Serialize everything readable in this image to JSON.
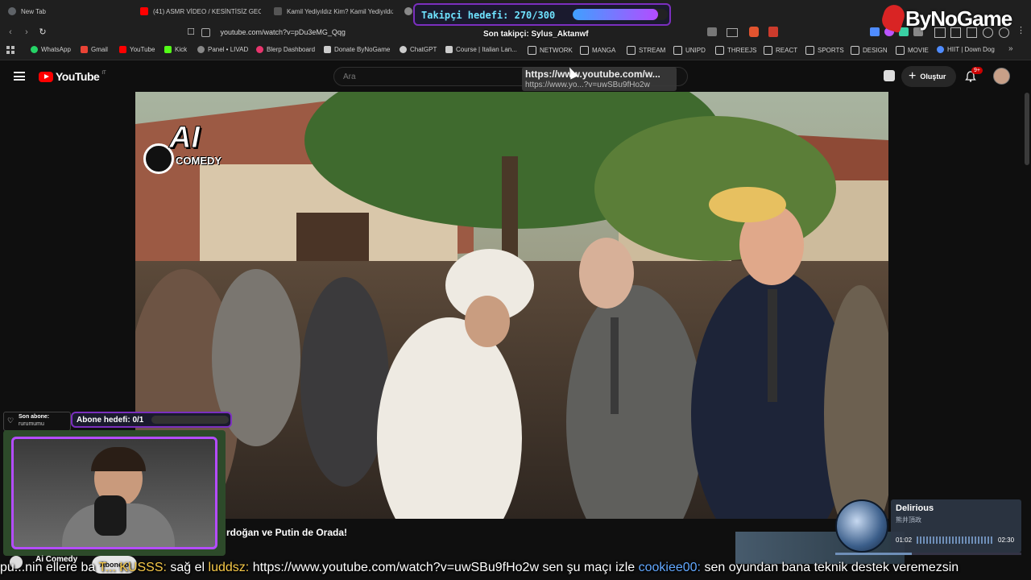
{
  "tabs": [
    {
      "label": "New Tab",
      "color": "#9aa0a6"
    },
    {
      "label": "(41) ASMR VİDEO / KESİNTİSİZ GECE",
      "color": "#ff0000"
    },
    {
      "label": "Kamil Yediyıldız Kim? Kamil Yediyıldız",
      "color": "#444444"
    },
    {
      "label": "",
      "color": "#888888"
    }
  ],
  "address": {
    "url": "youtube.com/watch?v=pDu3eMG_Qqg"
  },
  "bookmarks": [
    {
      "label": "WhatsApp",
      "color": "#25d366"
    },
    {
      "label": "Gmail",
      "color": "#ea4335"
    },
    {
      "label": "YouTube",
      "color": "#ff0000"
    },
    {
      "label": "Kick",
      "color": "#53fc18"
    },
    {
      "label": "Panel • LIVAD",
      "color": "#888888"
    },
    {
      "label": "Blerp Dashboard",
      "color": "#e8356d"
    },
    {
      "label": "Donate ByNoGame",
      "color": "#cccccc"
    },
    {
      "label": "ChatGPT",
      "color": "#cccccc"
    },
    {
      "label": "Course | Italian Lan...",
      "color": "#cccccc"
    },
    {
      "label": "NETWORK",
      "color": "folder"
    },
    {
      "label": "MANGA",
      "color": "folder"
    },
    {
      "label": "STREAM",
      "color": "folder"
    },
    {
      "label": "UNIPD",
      "color": "folder"
    },
    {
      "label": "THREEJS",
      "color": "folder"
    },
    {
      "label": "REACT",
      "color": "folder"
    },
    {
      "label": "SPORTS",
      "color": "folder"
    },
    {
      "label": "DESIGN",
      "color": "folder"
    },
    {
      "label": "MOVIE",
      "color": "folder"
    },
    {
      "label": "HIIT | Down Dog",
      "color": "#4f8cff"
    }
  ],
  "youtube": {
    "logo_text": "YouTube",
    "country": "IT",
    "search_placeholder": "Ara",
    "create_label": "Oluştur",
    "notif_badge": "9+",
    "link_tooltip_1": "https://www.youtube.com/w...",
    "link_tooltip_2": "https://www.yo...?v=uwSBu9fHo2w"
  },
  "video": {
    "watermark_ai": "AI",
    "watermark_comedy": "COMEDY",
    "title_visible": "rdoğan ve Putin de Orada!",
    "channel": "Ai Comedy",
    "subscribe_label": "Abone ol"
  },
  "stream": {
    "follower_goal_label": "Takipçi hedefi: 270/300",
    "follower_goal_progress": 0.9,
    "last_follower": "Son takipçi: Sylus_Aktanwf",
    "brand": "ByNoGame",
    "last_sub_label": "Son abone:",
    "last_sub_name": "rurumumu",
    "sub_goal_label": "Abone hedefi: 0/1",
    "sub_goal_progress": 0.0
  },
  "music": {
    "title": "Delirious",
    "subtitle": "熊井頂政",
    "elapsed": "01:02",
    "total": "02:30",
    "progress": 0.41
  },
  "ticker": {
    "parts": [
      {
        "text": "pu...nin ellere ba",
        "color": "#ffffff"
      },
      {
        "text": "T... KUSSS:",
        "color": "#f7c948"
      },
      {
        "text": "sağ el",
        "color": "#ffffff"
      },
      {
        "text": "luddsz:",
        "color": "#f7c948"
      },
      {
        "text": "https://www.youtube.com/watch?v=uwSBu9fHo2w sen şu maçı izle",
        "color": "#ffffff"
      },
      {
        "text": "cookiee00:",
        "color": "#62a8ff"
      },
      {
        "text": "sen oyundan bana teknik destek veremezsin",
        "color": "#ffffff"
      }
    ]
  }
}
